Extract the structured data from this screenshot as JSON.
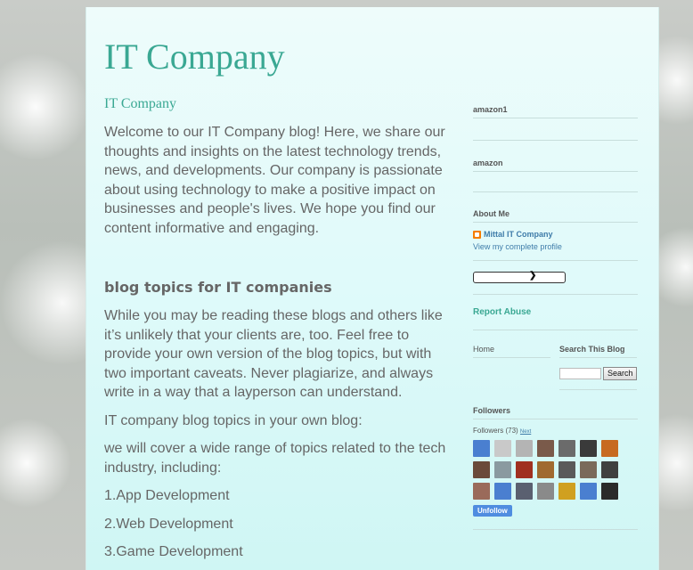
{
  "blog": {
    "title": "IT Company"
  },
  "post": {
    "title": "IT Company",
    "intro": "Welcome to our IT Company blog! Here, we share our thoughts and insights on the latest technology trends, news, and developments. Our company is passionate about using technology to make a positive impact on businesses and people's lives. We hope you find our content informative and engaging.",
    "section_heading": "blog topics for IT companies",
    "para2": "While you may be reading these blogs and others like it’s unlikely that your clients are, too. Feel free to provide your own version of the blog topics, but with two important caveats. Never plagiarize, and always write in a way that a layperson can understand.",
    "line1": " IT company blog topics in your own blog:",
    "line2": "we  will cover a wide range of topics related to the tech industry, including:",
    "list": [
      "1.App Development",
      "2.Web Development",
      "3.Game Development"
    ]
  },
  "sidebar": {
    "widget1_title": "amazon1",
    "widget2_title": "amazon",
    "about_title": "About Me",
    "profile_name": "Mittal IT Company",
    "profile_link": "View my complete profile",
    "report_abuse": "Report Abuse",
    "home_link": "Home",
    "search_title": "Search This Blog",
    "search_button": "Search",
    "followers_title": "Followers",
    "followers_count_label": "Followers (73)",
    "followers_next": "Next",
    "unfollow_label": "Unfollow",
    "thumb_colors": [
      "#4a7fd0",
      "#c9c9c9",
      "#b4b4b4",
      "#7a5a4a",
      "#6b6b6b",
      "#3a3a3a",
      "#c76a20",
      "#6a4a3a",
      "#8a9aa0",
      "#a03020",
      "#a06a30",
      "#5a5a5a",
      "#7a6a5a",
      "#404040",
      "#9a6a5a",
      "#4a7fd0",
      "#5a6070",
      "#8a8a8a",
      "#d0a020",
      "#4a7fd0",
      "#2a2a2a"
    ]
  },
  "colors": {
    "title": "#3aa893",
    "body_text": "#666666",
    "link": "#3f7ca9",
    "accent_button": "#4f8de0"
  }
}
